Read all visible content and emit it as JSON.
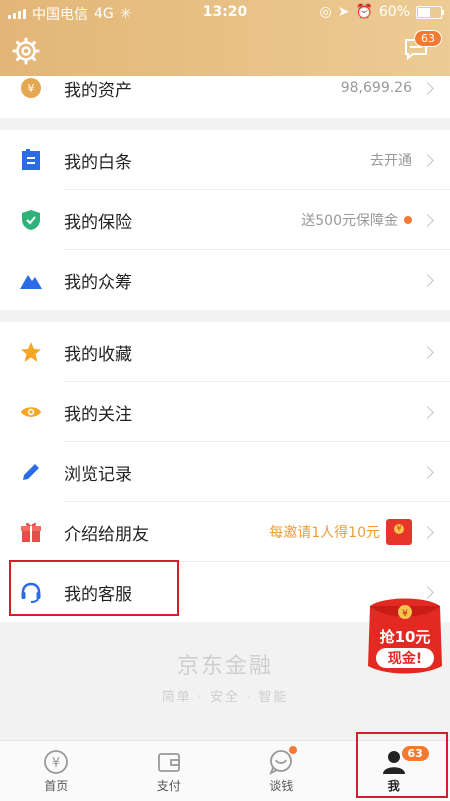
{
  "status_bar": {
    "carrier": "中国电信",
    "network": "4G",
    "time": "13:20",
    "battery": "60%",
    "battery_level": 0.6
  },
  "header": {
    "settings_icon": "gear-icon",
    "message_icon": "message-icon",
    "message_badge": "63"
  },
  "assets": {
    "label": "我的资产",
    "value": "98,699.26"
  },
  "group2": [
    {
      "label": "我的白条",
      "value": "去开通",
      "icon": "baitiao-icon",
      "color": "#2b6be6"
    },
    {
      "label": "我的保险",
      "value": "送500元保障金",
      "icon": "shield-icon",
      "color": "#2db37a"
    },
    {
      "label": "我的众筹",
      "value": "",
      "icon": "mountain-icon",
      "color": "#2b6be6"
    }
  ],
  "group3": [
    {
      "label": "我的收藏",
      "value": "",
      "icon": "star-icon",
      "color": "#f5a623"
    },
    {
      "label": "我的关注",
      "value": "",
      "icon": "eye-icon",
      "color": "#f5a623"
    },
    {
      "label": "浏览记录",
      "value": "",
      "icon": "pen-icon",
      "color": "#2b6be6"
    },
    {
      "label": "介绍给朋友",
      "value": "每邀请1人得10元",
      "icon": "gift-icon",
      "color": "#e2504a"
    },
    {
      "label": "我的客服",
      "value": "",
      "icon": "headset-icon",
      "color": "#2b6be6"
    }
  ],
  "brand": {
    "logo": "京东金融",
    "slogan": "简单 · 安全 · 智能"
  },
  "promo": {
    "line1": "抢10元",
    "line2": "现金!"
  },
  "tabs": [
    {
      "label": "首页",
      "icon": "yuan-circle-icon"
    },
    {
      "label": "支付",
      "icon": "wallet-icon"
    },
    {
      "label": "谈钱",
      "icon": "chat-icon"
    },
    {
      "label": "我",
      "icon": "person-icon",
      "badge": "63"
    }
  ]
}
